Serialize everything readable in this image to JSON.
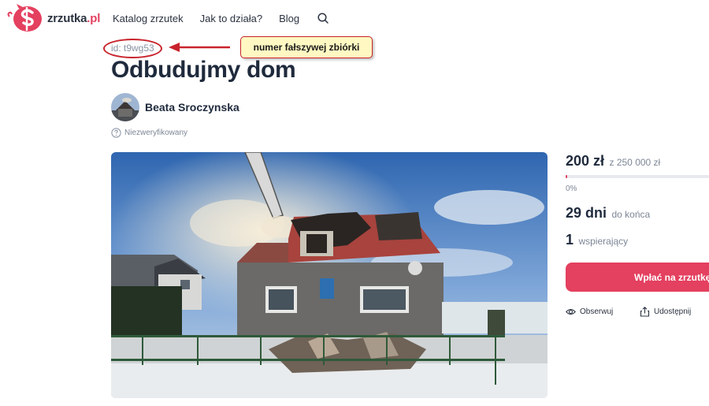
{
  "header": {
    "logo_text_main": "zrzutka",
    "logo_text_domain": ".pl",
    "nav": [
      "Katalog zrzutek",
      "Jak to działa?",
      "Blog"
    ],
    "search_icon": "search-icon"
  },
  "annotation": {
    "id_text": "id: t9wg53",
    "callout_text": "numer fałszywej zbiórki",
    "highlight_color": "#c8232c",
    "callout_bg": "#fff8c2"
  },
  "campaign": {
    "title": "Odbudujmy dom",
    "author": "Beata Sroczynska",
    "verification": "Niezweryfikowany"
  },
  "stats": {
    "raised": "200 zł",
    "goal": "z 250 000 zł",
    "progress_fraction": 0.0008,
    "progress_label": "0%",
    "days_value": "29 dni",
    "days_label": "do końca",
    "supporters_value": "1",
    "supporters_label": "wspierający"
  },
  "actions": {
    "pay_label": "Wpłać na zrzutkę",
    "follow_label": "Obserwuj",
    "share_label": "Udostępnij"
  },
  "colors": {
    "accent": "#e4405f",
    "text": "#1f2a3c",
    "muted": "#7d8696"
  }
}
